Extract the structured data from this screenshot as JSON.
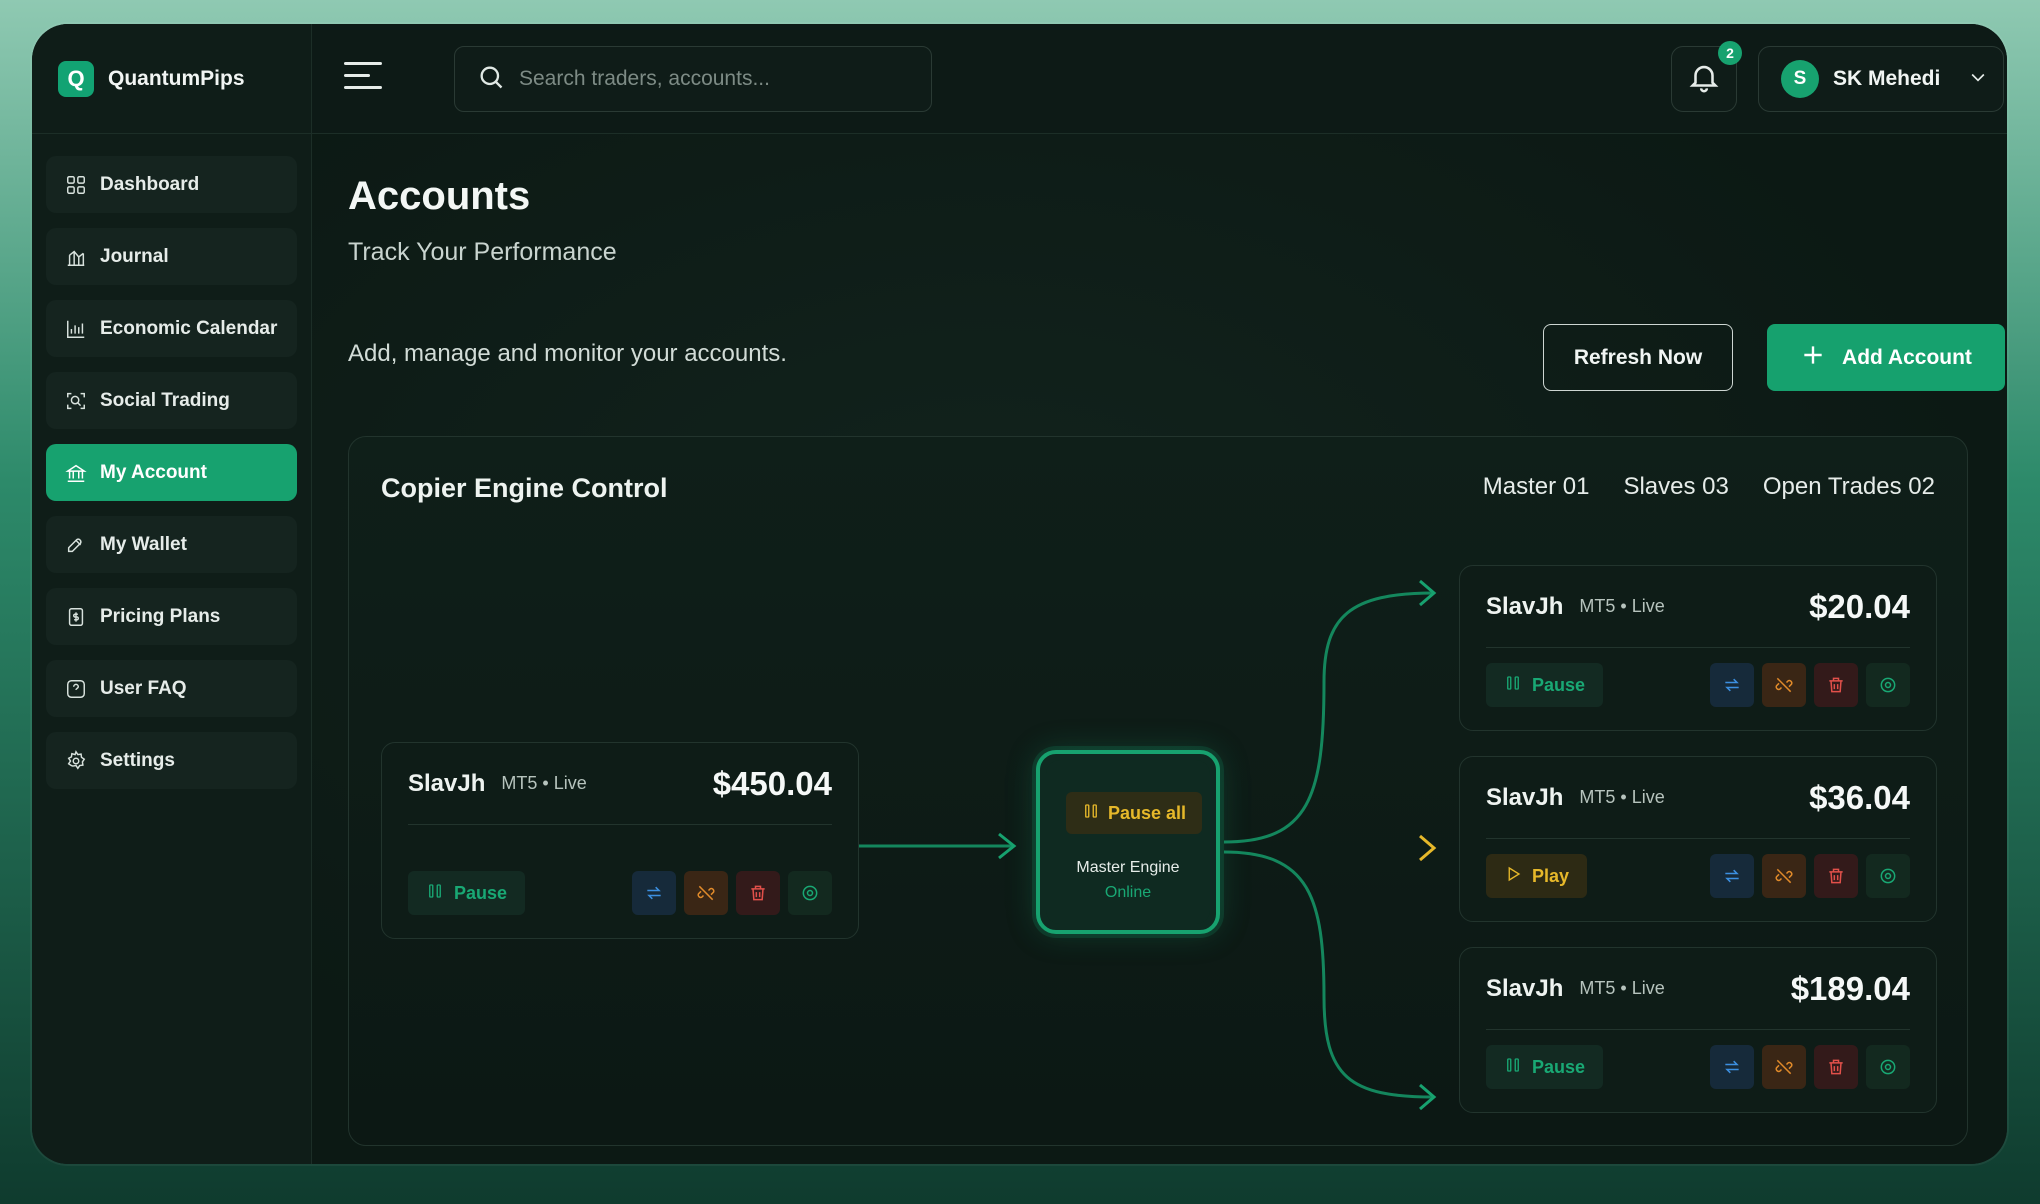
{
  "brand": {
    "logo_letter": "Q",
    "name": "QuantumPips"
  },
  "sidebar": {
    "items": [
      {
        "label": "Dashboard",
        "icon": "grid-icon",
        "active": false
      },
      {
        "label": "Journal",
        "icon": "journal-icon",
        "active": false
      },
      {
        "label": "Economic Calendar",
        "icon": "chart-icon",
        "active": false
      },
      {
        "label": "Social Trading",
        "icon": "search-frame-icon",
        "active": false
      },
      {
        "label": "My Account",
        "icon": "bank-icon",
        "active": true
      },
      {
        "label": "My Wallet",
        "icon": "wallet-icon",
        "active": false
      },
      {
        "label": "Pricing Plans",
        "icon": "receipt-icon",
        "active": false
      },
      {
        "label": "User FAQ",
        "icon": "question-icon",
        "active": false
      },
      {
        "label": "Settings",
        "icon": "gear-icon",
        "active": false
      }
    ]
  },
  "header": {
    "search_placeholder": "Search traders, accounts...",
    "notification_count": "2",
    "user": {
      "initial": "S",
      "name": "SK Mehedi"
    }
  },
  "page": {
    "title": "Accounts",
    "subtitle": "Track Your Performance",
    "description": "Add, manage and monitor your accounts.",
    "refresh_label": "Refresh Now",
    "add_label": "Add Account"
  },
  "copier": {
    "title": "Copier Engine Control",
    "stats": {
      "master": "Master 01",
      "slaves": "Slaves 03",
      "open_trades": "Open Trades 02"
    },
    "master_account": {
      "name": "SlavJh",
      "meta": "MT5 • Live",
      "balance": "$450.04",
      "action": "Pause"
    },
    "engine": {
      "pause_all": "Pause all",
      "label": "Master Engine",
      "status": "Online"
    },
    "slaves": [
      {
        "name": "SlavJh",
        "meta": "MT5 • Live",
        "balance": "$20.04",
        "action": "Pause"
      },
      {
        "name": "SlavJh",
        "meta": "MT5 • Live",
        "balance": "$36.04",
        "action": "Play"
      },
      {
        "name": "SlavJh",
        "meta": "MT5 • Live",
        "balance": "$189.04",
        "action": "Pause"
      }
    ]
  },
  "colors": {
    "accent": "#17a26f",
    "warning": "#e6b82a",
    "danger": "#e2504a",
    "info": "#3c8fe0",
    "orange": "#e08a2a"
  }
}
